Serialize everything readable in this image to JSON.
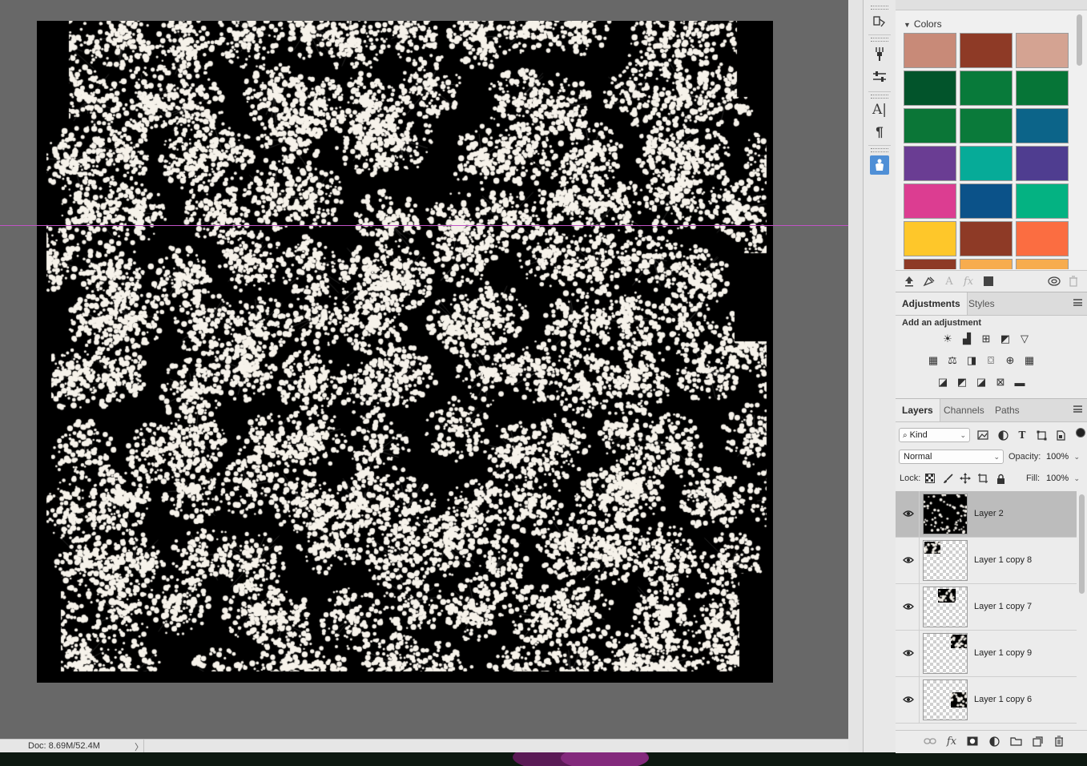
{
  "statusbar": {
    "doc_info": "Doc: 8.69M/52.4M",
    "arrow": "〉"
  },
  "colors": {
    "panel_title": "Colors",
    "swatches": [
      "#c88a78",
      "#8e3a26",
      "#d4a392",
      "#02542b",
      "#087a3a",
      "#067537",
      "#0b7637",
      "#0a7a3a",
      "#0c6489",
      "#6a3d93",
      "#06ab98",
      "#4f3d90",
      "#dc3d91",
      "#0b5289",
      "#04b282",
      "#fec72a",
      "#8e3a26",
      "#fb6d41",
      "#8e3a26",
      "#f7ac4e",
      "#f7ac4e"
    ]
  },
  "adjustments": {
    "tabs": [
      "Adjustments",
      "Styles"
    ],
    "add_label": "Add an adjustment",
    "icons": [
      "brightness-contrast-icon",
      "levels-icon",
      "curves-icon",
      "exposure-icon",
      "vibrance-icon",
      "hue-saturation-icon",
      "color-balance-icon",
      "black-white-icon",
      "photo-filter-icon",
      "channel-mixer-icon",
      "color-lookup-icon",
      "invert-icon",
      "posterize-icon",
      "threshold-icon",
      "selective-color-icon",
      "gradient-map-icon"
    ]
  },
  "layers": {
    "tabs": [
      "Layers",
      "Channels",
      "Paths"
    ],
    "filter_kind": "Kind",
    "blend_mode": "Normal",
    "opacity_label": "Opacity:",
    "opacity_value": "100%",
    "lock_label": "Lock:",
    "fill_label": "Fill:",
    "fill_value": "100%",
    "items": [
      {
        "name": "Layer 2",
        "selected": true
      },
      {
        "name": "Layer 1 copy 8",
        "selected": false
      },
      {
        "name": "Layer 1 copy 7",
        "selected": false
      },
      {
        "name": "Layer 1 copy 9",
        "selected": false
      },
      {
        "name": "Layer 1 copy 6",
        "selected": false
      }
    ]
  },
  "theme": {
    "guide_color": "#c154c6",
    "selection_color": "#bcbcbc",
    "active_tool_color": "#4f8fd6"
  }
}
